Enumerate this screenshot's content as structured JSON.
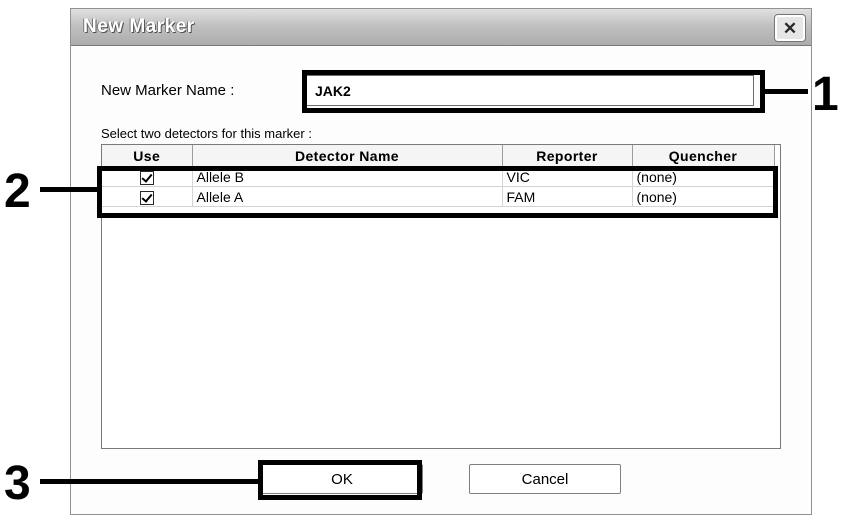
{
  "dialog": {
    "title": "New Marker",
    "close_glyph": "✕",
    "name_label": "New Marker Name :",
    "name_value": "JAK2",
    "select_label": "Select two detectors for this marker :",
    "columns": [
      "Use",
      "Detector Name",
      "Reporter",
      "Quencher"
    ],
    "rows": [
      {
        "use": true,
        "detector": "Allele B",
        "reporter": "VIC",
        "quencher": "(none)"
      },
      {
        "use": true,
        "detector": "Allele A",
        "reporter": "FAM",
        "quencher": "(none)"
      }
    ],
    "ok_label": "OK",
    "cancel_label": "Cancel"
  },
  "callouts": [
    "1",
    "2",
    "3"
  ]
}
